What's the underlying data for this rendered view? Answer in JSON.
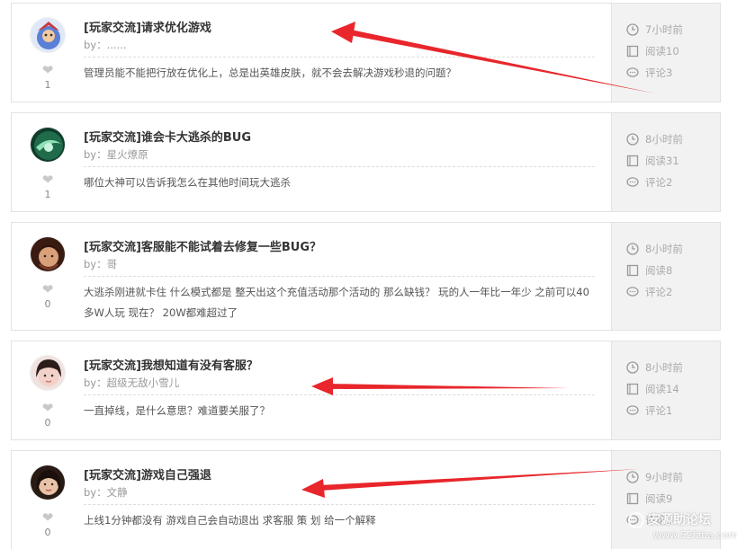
{
  "posts": [
    {
      "title": "[玩家交流]请求优化游戏",
      "author": "by：......",
      "excerpt": "管理员能不能把行放在优化上，总是出英雄皮肤，就不会去解决游戏秒退的问题？",
      "likes": "1",
      "time": "7小时前",
      "views": "阅读10",
      "comments": "评论3",
      "avatar_color": "#5a7fd6"
    },
    {
      "title": "[玩家交流]谁会卡大逃杀的BUG",
      "author": "by：星火燎原",
      "excerpt": "哪位大神可以告诉我怎么在其他时间玩大逃杀",
      "likes": "1",
      "time": "8小时前",
      "views": "阅读31",
      "comments": "评论2",
      "avatar_color": "#1f6b4a"
    },
    {
      "title": "[玩家交流]客服能不能试着去修复一些BUG？",
      "author": "by：哥",
      "excerpt": "大逃杀刚进就卡住 什么模式都是 整天出这个充值活动那个活动的 那么缺钱？ 玩的人一年比一年少 之前可以40多W人玩 现在？ 20W都难超过了",
      "likes": "0",
      "time": "8小时前",
      "views": "阅读8",
      "comments": "评论2",
      "avatar_color": "#7a3a28"
    },
    {
      "title": "[玩家交流]我想知道有没有客服？",
      "author": "by：超级无敌小雪儿",
      "excerpt": "一直掉线，是什么意思？难道要关服了？",
      "likes": "0",
      "time": "8小时前",
      "views": "阅读14",
      "comments": "评论1",
      "avatar_color": "#c9a6a0"
    },
    {
      "title": "[玩家交流]游戏自己强退",
      "author": "by：文静",
      "excerpt": "上线1分钟都没有 游戏自己会自动退出 求客服 策 划 给一个解释",
      "likes": "0",
      "time": "9小时前",
      "views": "阅读9",
      "comments": "评论3",
      "avatar_color": "#4a3026"
    }
  ],
  "icons": {
    "like": "heart-icon",
    "time": "clock-icon",
    "views": "book-icon",
    "comments": "comment-icon"
  },
  "annotation_color": "#e8262b",
  "watermark": {
    "main": "安源助论坛",
    "sub": "www.52fzba.com"
  }
}
